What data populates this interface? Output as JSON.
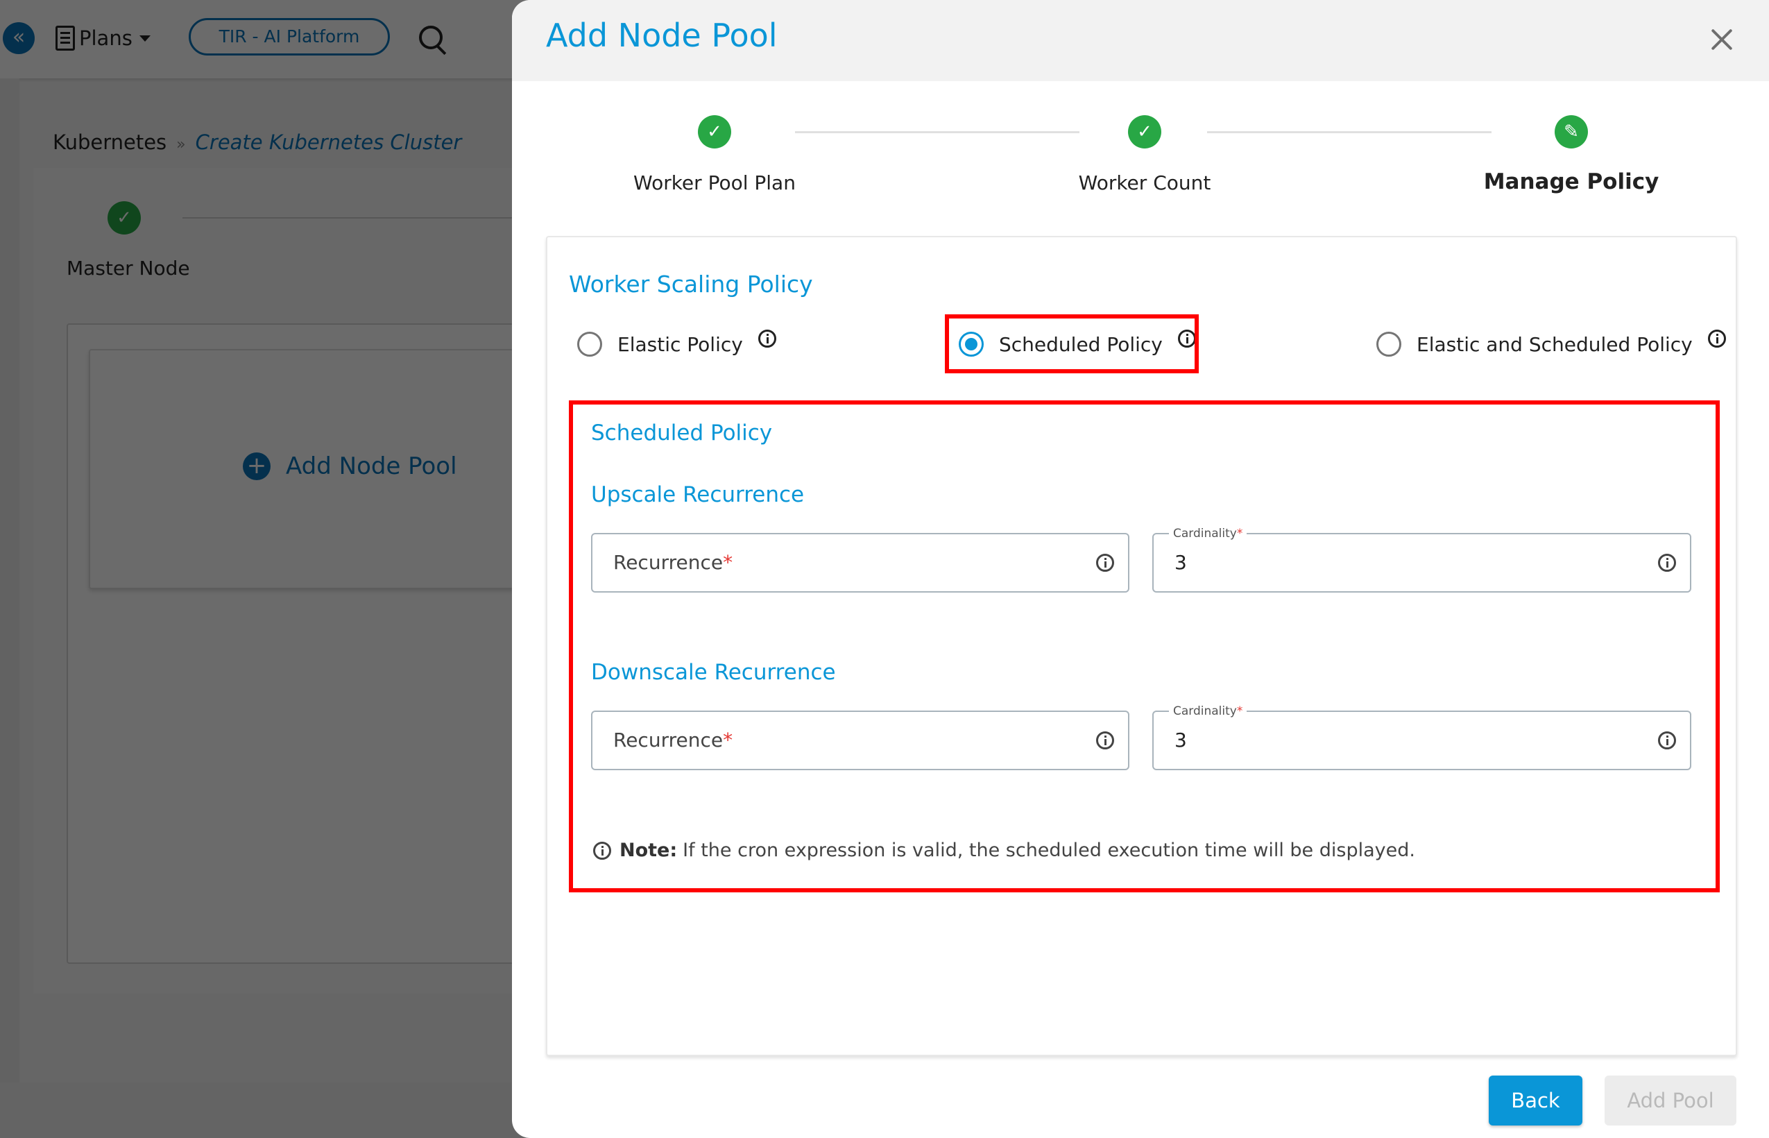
{
  "background": {
    "nav": {
      "plans_label": "Plans",
      "platform_label": "TIR - AI Platform"
    },
    "breadcrumb": {
      "root": "Kubernetes",
      "separator": "»",
      "current": "Create Kubernetes Cluster"
    },
    "stepper": {
      "step1_label": "Master Node"
    },
    "add_node_pool_label": "Add Node Pool"
  },
  "drawer": {
    "title": "Add Node Pool",
    "steps": [
      {
        "label": "Worker Pool Plan",
        "status": "complete"
      },
      {
        "label": "Worker Count",
        "status": "complete"
      },
      {
        "label": "Manage Policy",
        "status": "active"
      }
    ],
    "scaling": {
      "title": "Worker Scaling Policy",
      "options": [
        {
          "label": "Elastic Policy",
          "checked": false
        },
        {
          "label": "Scheduled Policy",
          "checked": true
        },
        {
          "label": "Elastic and Scheduled Policy",
          "checked": false
        }
      ]
    },
    "scheduled": {
      "title": "Scheduled Policy",
      "upscale": {
        "title": "Upscale Recurrence",
        "recurrence_placeholder": "Recurrence",
        "cardinality_label": "Cardinality",
        "cardinality_value": "3"
      },
      "downscale": {
        "title": "Downscale Recurrence",
        "recurrence_placeholder": "Recurrence",
        "cardinality_label": "Cardinality",
        "cardinality_value": "3"
      },
      "required_marker": "*",
      "note_label": "Note:",
      "note_text": "If the cron expression is valid, the scheduled execution time will be displayed."
    },
    "buttons": {
      "back": "Back",
      "add_pool": "Add Pool"
    }
  },
  "colors": {
    "accent": "#0a96d7",
    "success": "#28a745",
    "highlight": "#ff0000",
    "required": "#e53935"
  }
}
